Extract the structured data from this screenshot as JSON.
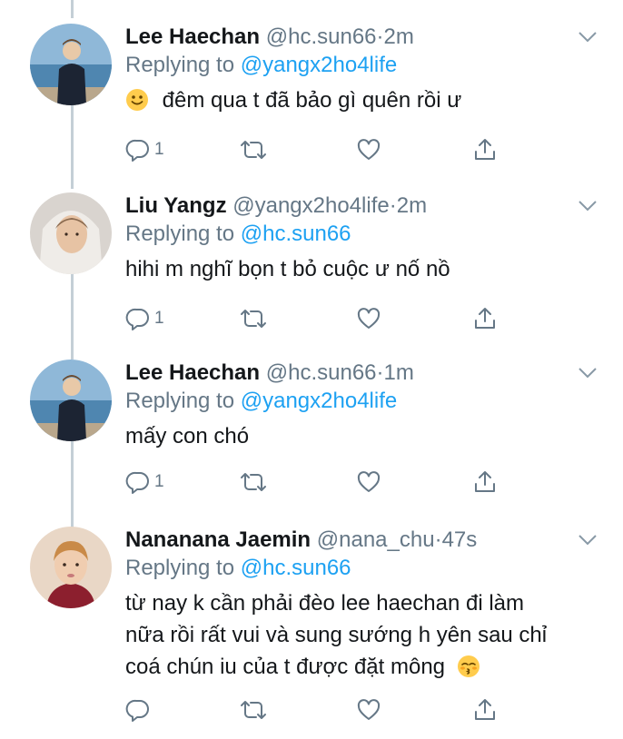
{
  "tweets": [
    {
      "name": "Lee Haechan",
      "handle": "@hc.sun66",
      "dot": "·",
      "time": "2m",
      "reply_prefix": "Replying to ",
      "reply_to": "@yangx2ho4life",
      "text": "đêm qua t đã bảo gì quên rồi ư",
      "emoji": "slightly-smiling-face",
      "reply_count": "1"
    },
    {
      "name": "Liu Yangz",
      "handle": "@yangx2ho4life",
      "dot": "·",
      "time": "2m",
      "reply_prefix": "Replying to ",
      "reply_to": "@hc.sun66",
      "text": "hihi m nghĩ bọn t bỏ cuộc ư nố nồ",
      "reply_count": "1"
    },
    {
      "name": "Lee Haechan",
      "handle": "@hc.sun66",
      "dot": "·",
      "time": "1m",
      "reply_prefix": "Replying to ",
      "reply_to": "@yangx2ho4life",
      "text": "mấy con chó",
      "reply_count": "1"
    },
    {
      "name": "Nananana Jaemin",
      "handle": "@nana_chu",
      "dot": "·",
      "time": "47s",
      "reply_prefix": "Replying to ",
      "reply_to": "@hc.sun66",
      "text_lines": [
        "từ nay k cần phải đèo lee haechan đi làm",
        "nữa rồi rất vui và sung sướng h yên sau chỉ",
        "coá chún iu của t được đặt mông"
      ],
      "emoji": "kissing-face-closed-eyes",
      "reply_count": ""
    }
  ],
  "colors": {
    "text": "#14171a",
    "secondary": "#657786",
    "link": "#1da1f2",
    "thread_line": "#c4cfd6"
  }
}
